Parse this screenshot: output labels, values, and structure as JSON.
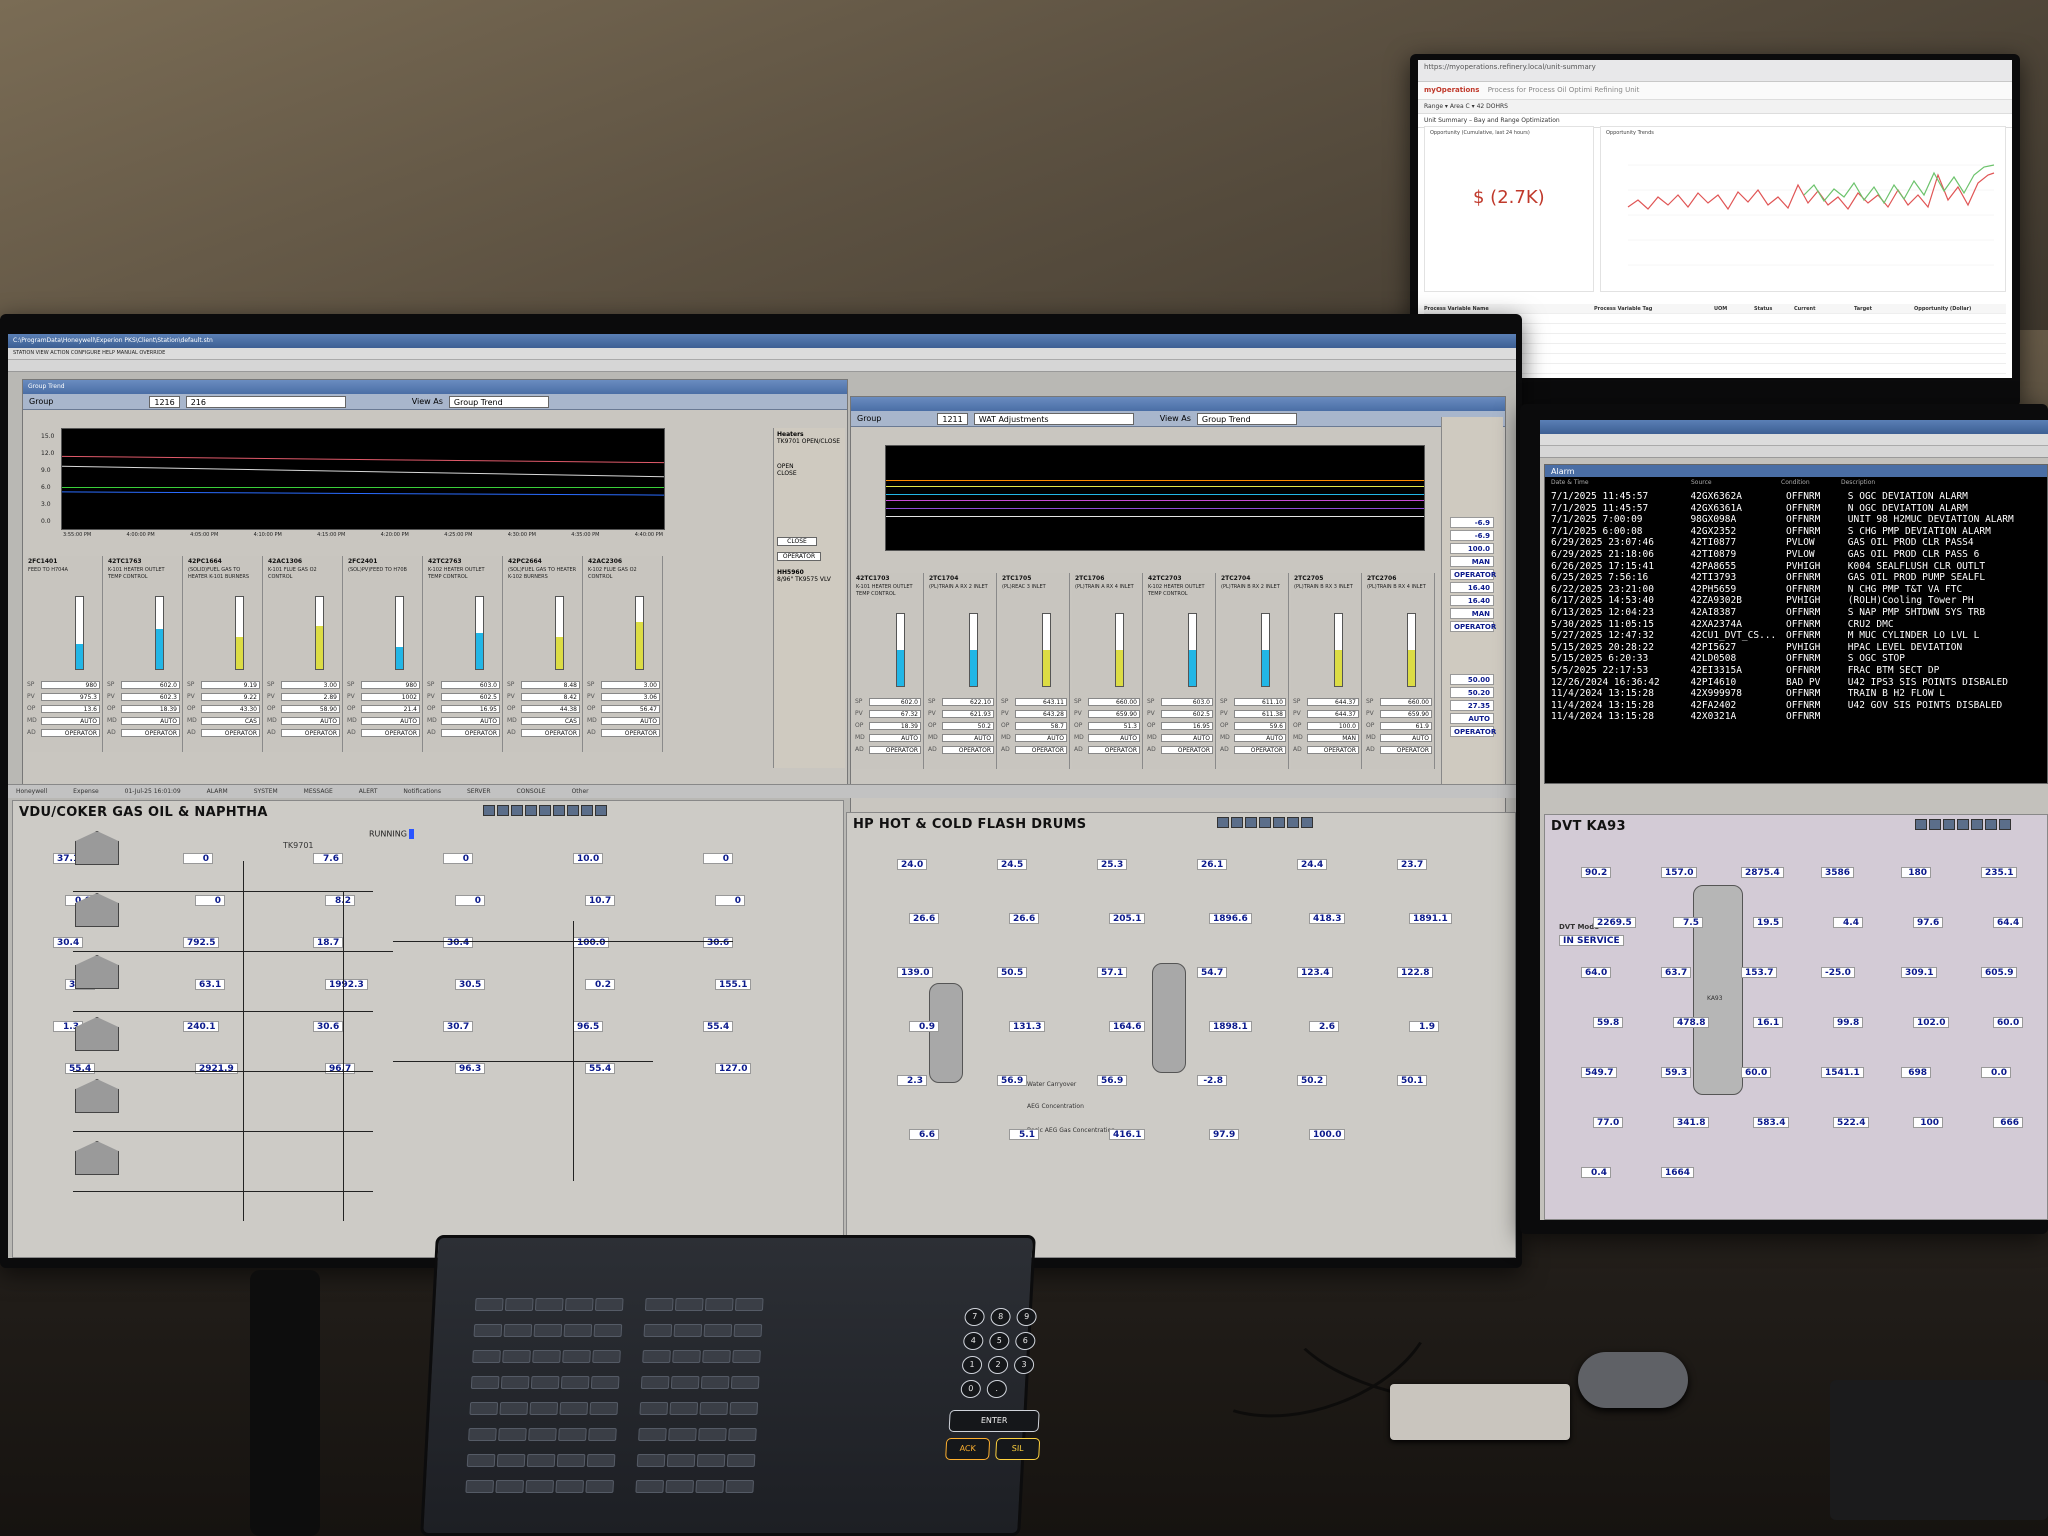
{
  "web_monitor": {
    "brand": "myOperations",
    "tagline": "Process for Process Oil Optimi Refining Unit",
    "filters": "Range ▾  Area C ▾  42 DOHRS",
    "breadcrumb": "Unit Summary – Bay and Range Optimization",
    "opportunity_title": "Opportunity (Cumulative, last 24 hours)",
    "opportunity_value": "$ (2.7K)",
    "trend_title": "Opportunity Trends",
    "table_headers": [
      "Process Variable Name",
      "Process Variable Tag",
      "UOM",
      "Status",
      "Current",
      "Target",
      "Opportunity (Dollar)"
    ]
  },
  "left_monitor": {
    "group_window": {
      "title": "Group Trend",
      "group_label": "Group",
      "group_number": "1216",
      "group_name": "216",
      "view_as_label": "View As",
      "view_as_value": "Group Trend",
      "y_ticks": [
        "15.0",
        "12.0",
        "9.0",
        "6.0",
        "3.0",
        "0.0"
      ],
      "x_ticks": [
        "3:55:00 PM",
        "4:00:00 PM",
        "4:05:00 PM",
        "4:10:00 PM",
        "4:15:00 PM",
        "4:20:00 PM",
        "4:25:00 PM",
        "4:30:00 PM",
        "4:35:00 PM",
        "4:40:00 PM"
      ]
    },
    "faceplates": [
      {
        "tag": "2FC1401",
        "desc": "FEED TO H704A",
        "sp": "980",
        "pv": "975.3",
        "op": "13.6",
        "md": "AUTO",
        "ad": "OPERATOR",
        "fill": 0.35
      },
      {
        "tag": "42TC1763",
        "desc": "K-101 HEATER OUTLET TEMP CONTROL",
        "sp": "602.0",
        "pv": "602.3",
        "op": "18.39",
        "md": "AUTO",
        "ad": "OPERATOR",
        "fill": 0.55
      },
      {
        "tag": "42PC1664",
        "desc": "(SOLID)FUEL GAS TO HEATER K-101 BURNERS",
        "sp": "9.19",
        "pv": "9.22",
        "op": "43.30",
        "md": "CAS",
        "ad": "OPERATOR",
        "fill": 0.45
      },
      {
        "tag": "42AC1306",
        "desc": "K-101 FLUE GAS O2 CONTROL",
        "sp": "3.00",
        "pv": "2.89",
        "op": "58.90",
        "md": "AUTO",
        "ad": "OPERATOR",
        "fill": 0.6
      },
      {
        "tag": "2FC2401",
        "desc": "(SOL)PV)FEED TO H70B",
        "sp": "980",
        "pv": "1002",
        "op": "21.4",
        "md": "AUTO",
        "ad": "OPERATOR",
        "fill": 0.3
      },
      {
        "tag": "42TC2763",
        "desc": "K-102 HEATER OUTLET TEMP CONTROL",
        "sp": "603.0",
        "pv": "602.5",
        "op": "16.95",
        "md": "AUTO",
        "ad": "OPERATOR",
        "fill": 0.5
      },
      {
        "tag": "42PC2664",
        "desc": "(SOL)FUEL GAS TO HEATER K-102 BURNERS",
        "sp": "8.48",
        "pv": "8.42",
        "op": "44.38",
        "md": "CAS",
        "ad": "OPERATOR",
        "fill": 0.45
      },
      {
        "tag": "42AC2306",
        "desc": "K-102 FLUE GAS O2 CONTROL",
        "sp": "3.00",
        "pv": "3.06",
        "op": "56.47",
        "md": "AUTO",
        "ad": "OPERATOR",
        "fill": 0.65
      }
    ],
    "side_panel": {
      "tag": "Heaters",
      "desc": "TK9701 OPEN/CLOSE",
      "open": "OPEN",
      "close": "CLOSE",
      "close_btn": "CLOSE",
      "operator": "OPERATOR",
      "tag2": "HH5960",
      "desc2": "8/96\" TK9575 VLV"
    },
    "status_items": [
      "Honeywell",
      "Expense",
      "01-Jul-25  16:01:09",
      "ALARM",
      "SYSTEM",
      "MESSAGE",
      "ALERT",
      "Notifications",
      "SERVER",
      "CONSOLE",
      "Other"
    ],
    "schematic_title": "VDU/COKER GAS OIL & NAPHTHA",
    "schematic_values": [
      {
        "id": "v1",
        "val": "37.1"
      },
      {
        "id": "v2",
        "val": "0"
      },
      {
        "id": "v3",
        "val": "7.6"
      },
      {
        "id": "v4",
        "val": "0"
      },
      {
        "id": "v5",
        "val": "10.0"
      },
      {
        "id": "v6",
        "val": "0"
      },
      {
        "id": "v7",
        "val": "0.0"
      },
      {
        "id": "v8",
        "val": "0"
      },
      {
        "id": "v9",
        "val": "8.2"
      },
      {
        "id": "v10",
        "val": "0"
      },
      {
        "id": "v11",
        "val": "10.7"
      },
      {
        "id": "v12",
        "val": "0"
      },
      {
        "id": "v13",
        "val": "30.4"
      },
      {
        "id": "v14",
        "val": "792.5"
      },
      {
        "id": "v15",
        "val": "18.7"
      },
      {
        "id": "v16",
        "val": "30.4"
      },
      {
        "id": "v17",
        "val": "100.0"
      },
      {
        "id": "v18",
        "val": "30.6"
      },
      {
        "id": "v19",
        "val": "30.5"
      },
      {
        "id": "v20",
        "val": "63.1"
      },
      {
        "id": "v21",
        "val": "1992.3"
      },
      {
        "id": "v22",
        "val": "30.5"
      },
      {
        "id": "v23",
        "val": "0.2"
      },
      {
        "id": "v24",
        "val": "155.1"
      },
      {
        "id": "v25",
        "val": "1.3"
      },
      {
        "id": "v26",
        "val": "240.1"
      },
      {
        "id": "v27",
        "val": "30.6"
      },
      {
        "id": "v28",
        "val": "30.7"
      },
      {
        "id": "v29",
        "val": "96.5"
      },
      {
        "id": "v30",
        "val": "55.4"
      },
      {
        "id": "v31",
        "val": "55.4"
      },
      {
        "id": "v32",
        "val": "2921.9"
      },
      {
        "id": "v33",
        "val": "96.7"
      },
      {
        "id": "v34",
        "val": "96.3"
      },
      {
        "id": "v35",
        "val": "55.4"
      },
      {
        "id": "v36",
        "val": "127.0"
      }
    ],
    "running_label": "RUNNING",
    "tk_label": "TK9701"
  },
  "middle_window": {
    "group_number": "1211",
    "group_name": "WAT Adjustments",
    "view_as_value": "Group Trend",
    "faceplates": [
      {
        "tag": "42TC1703",
        "desc": "K-101 HEATER OUTLET TEMP CONTROL",
        "sp": "602.0",
        "pv": "67.32",
        "op": "18.39",
        "md": "AUTO",
        "ad": "OPERATOR"
      },
      {
        "tag": "2TC1704",
        "desc": "(PL)TRAIN A RX 2 INLET",
        "sp": "622.10",
        "pv": "621.93",
        "op": "50.2",
        "md": "AUTO",
        "ad": "OPERATOR"
      },
      {
        "tag": "2TC1705",
        "desc": "(PL)REAC 3 INLET",
        "sp": "643.11",
        "pv": "643.28",
        "op": "58.7",
        "md": "AUTO",
        "ad": "OPERATOR"
      },
      {
        "tag": "2TC1706",
        "desc": "(PL)TRAIN A RX 4 INLET",
        "sp": "660.00",
        "pv": "659.90",
        "op": "51.3",
        "md": "AUTO",
        "ad": "OPERATOR"
      },
      {
        "tag": "42TC2703",
        "desc": "K-102 HEATER OUTLET TEMP CONTROL",
        "sp": "603.0",
        "pv": "602.5",
        "op": "16.95",
        "md": "AUTO",
        "ad": "OPERATOR"
      },
      {
        "tag": "2TC2704",
        "desc": "(PL)TRAIN B RX 2 INLET",
        "sp": "611.10",
        "pv": "611.38",
        "op": "59.6",
        "md": "AUTO",
        "ad": "OPERATOR"
      },
      {
        "tag": "2TC2705",
        "desc": "(PL)TRAIN B RX 3 INLET",
        "sp": "644.37",
        "pv": "644.37",
        "op": "100.0",
        "md": "MAN",
        "ad": "OPERATOR"
      },
      {
        "tag": "2TC2706",
        "desc": "(PL)TRAIN B RX 4 INLET",
        "sp": "660.00",
        "pv": "659.90",
        "op": "61.9",
        "md": "AUTO",
        "ad": "OPERATOR"
      }
    ],
    "schematic_title": "HP HOT & COLD FLASH DRUMS",
    "schematic_values": [
      {
        "id": "m1",
        "val": "24.0"
      },
      {
        "id": "m2",
        "val": "24.5"
      },
      {
        "id": "m3",
        "val": "25.3"
      },
      {
        "id": "m4",
        "val": "26.1"
      },
      {
        "id": "m5",
        "val": "24.4"
      },
      {
        "id": "m6",
        "val": "23.7"
      },
      {
        "id": "m7",
        "val": "26.6"
      },
      {
        "id": "m8",
        "val": "26.6"
      },
      {
        "id": "m9",
        "val": "205.1"
      },
      {
        "id": "m10",
        "val": "1896.6"
      },
      {
        "id": "m11",
        "val": "418.3"
      },
      {
        "id": "m12",
        "val": "1891.1"
      },
      {
        "id": "m13",
        "val": "139.0"
      },
      {
        "id": "m14",
        "val": "50.5"
      },
      {
        "id": "m15",
        "val": "57.1"
      },
      {
        "id": "m16",
        "val": "54.7"
      },
      {
        "id": "m17",
        "val": "123.4"
      },
      {
        "id": "m18",
        "val": "122.8"
      },
      {
        "id": "m19",
        "val": "0.9"
      },
      {
        "id": "m20",
        "val": "131.3"
      },
      {
        "id": "m21",
        "val": "164.6"
      },
      {
        "id": "m22",
        "val": "1898.1"
      },
      {
        "id": "m23",
        "val": "2.6"
      },
      {
        "id": "m24",
        "val": "1.9"
      },
      {
        "id": "m25",
        "val": "2.3"
      },
      {
        "id": "m26",
        "val": "56.9"
      },
      {
        "id": "m27",
        "val": "56.9"
      },
      {
        "id": "m28",
        "val": "-2.8"
      },
      {
        "id": "m29",
        "val": "50.2"
      },
      {
        "id": "m30",
        "val": "50.1"
      },
      {
        "id": "m31",
        "val": "6.6"
      },
      {
        "id": "m32",
        "val": "5.1"
      },
      {
        "id": "m33",
        "val": "416.1"
      },
      {
        "id": "m34",
        "val": "97.9"
      },
      {
        "id": "m35",
        "val": "100.0"
      }
    ],
    "labels": {
      "water_carryover": "Water Carryover",
      "aeg": "AEG Concentration",
      "basic": "Basic AEG Gas Concentration"
    },
    "side_values": [
      {
        "val": "-6.9"
      },
      {
        "val": "-6.9"
      },
      {
        "val": "100.0"
      },
      {
        "val": "MAN"
      },
      {
        "val": "OPERATOR"
      },
      {
        "val": "16.40"
      },
      {
        "val": "16.40"
      },
      {
        "val": "MAN"
      },
      {
        "val": "OPERATOR"
      },
      {
        "val": "50.00"
      },
      {
        "val": "50.20"
      },
      {
        "val": "27.35"
      },
      {
        "val": "AUTO"
      },
      {
        "val": "OPERATOR"
      }
    ]
  },
  "right_monitor": {
    "alarm_title": "Alarm",
    "columns": [
      "Date & Time",
      "Source",
      "Condition",
      "Description"
    ],
    "alarms": [
      {
        "time": "7/1/2025 11:45:57",
        "src": "42GX6362A",
        "cond": "OFFNRM",
        "desc": "S OGC DEVIATION ALARM"
      },
      {
        "time": "7/1/2025 11:45:57",
        "src": "42GX6361A",
        "cond": "OFFNRM",
        "desc": "N OGC DEVIATION ALARM"
      },
      {
        "time": "7/1/2025 7:00:09",
        "src": "98GX098A",
        "cond": "OFFNRM",
        "desc": "UNIT 98 H2MUC DEVIATION ALARM"
      },
      {
        "time": "7/1/2025 6:00:08",
        "src": "42GX2352",
        "cond": "OFFNRM",
        "desc": "S CHG PMP DEVIATION  ALARM"
      },
      {
        "time": "6/29/2025 23:07:46",
        "src": "42TI0877",
        "cond": "PVLOW",
        "desc": "GAS OIL PROD CLR PASS4"
      },
      {
        "time": "6/29/2025 21:18:06",
        "src": "42TI0879",
        "cond": "PVLOW",
        "desc": "GAS OIL PROD CLR PASS 6"
      },
      {
        "time": "6/26/2025 17:15:41",
        "src": "42PA8655",
        "cond": "PVHIGH",
        "desc": "K004 SEALFLUSH CLR OUTLT"
      },
      {
        "time": "6/25/2025 7:56:16",
        "src": "42TI3793",
        "cond": "OFFNRM",
        "desc": "GAS OIL PROD PUMP SEALFL"
      },
      {
        "time": "6/22/2025 23:21:00",
        "src": "42PH5659",
        "cond": "OFFNRM",
        "desc": "N CHG PMP T&T VA FTC"
      },
      {
        "time": "6/17/2025 14:53:40",
        "src": "42ZA9302B",
        "cond": "PVHIGH",
        "desc": "(ROLH)Cooling Tower PH"
      },
      {
        "time": "6/13/2025 12:04:23",
        "src": "42AI8387",
        "cond": "OFFNRM",
        "desc": "S NAP PMP SHTDWN SYS TRB"
      },
      {
        "time": "5/30/2025 11:05:15",
        "src": "42XA2374A",
        "cond": "OFFNRM",
        "desc": "CRU2 DMC"
      },
      {
        "time": "5/27/2025 12:47:32",
        "src": "42CU1_DVT_CS...",
        "cond": "OFFNRM",
        "desc": "M MUC CYLINDER LO LVL L"
      },
      {
        "time": "5/15/2025 20:28:22",
        "src": "42PI5627",
        "cond": "PVHIGH",
        "desc": "HPAC LEVEL DEVIATION"
      },
      {
        "time": "5/15/2025 6:20:33",
        "src": "42LD0508",
        "cond": "OFFNRM",
        "desc": "S OGC STOP"
      },
      {
        "time": "5/5/2025 22:17:53",
        "src": "42EI3315A",
        "cond": "OFFNRM",
        "desc": "FRAC BTM SECT DP"
      },
      {
        "time": "12/26/2024 16:36:42",
        "src": "42PI4610",
        "cond": "BAD PV",
        "desc": "U42 IPS3 SIS POINTS DISBALED"
      },
      {
        "time": "11/4/2024 13:15:28",
        "src": "42X999978",
        "cond": "OFFNRM",
        "desc": "TRAIN B H2 FLOW L"
      },
      {
        "time": "11/4/2024 13:15:28",
        "src": "42FA2402",
        "cond": "OFFNRM",
        "desc": "U42 GOV SIS POINTS DISBALED"
      },
      {
        "time": "11/4/2024 13:15:28",
        "src": "42X0321A",
        "cond": "OFFNRM",
        "desc": ""
      }
    ],
    "schematic_title": "DVT KA93",
    "schematic_values": [
      {
        "val": "90.2"
      },
      {
        "val": "157.0"
      },
      {
        "val": "2875.4"
      },
      {
        "val": "3586"
      },
      {
        "val": "180"
      },
      {
        "val": "235.1"
      },
      {
        "val": "2269.5"
      },
      {
        "val": "7.5"
      },
      {
        "val": "19.5"
      },
      {
        "val": "4.4"
      },
      {
        "val": "97.6"
      },
      {
        "val": "64.4"
      },
      {
        "val": "64.0"
      },
      {
        "val": "63.7"
      },
      {
        "val": "153.7"
      },
      {
        "val": "-25.0"
      },
      {
        "val": "309.1"
      },
      {
        "val": "605.9"
      },
      {
        "val": "59.8"
      },
      {
        "val": "478.8"
      },
      {
        "val": "16.1"
      },
      {
        "val": "99.8"
      },
      {
        "val": "102.0"
      },
      {
        "val": "60.0"
      },
      {
        "val": "549.7"
      },
      {
        "val": "59.3"
      },
      {
        "val": "60.0"
      },
      {
        "val": "1541.1"
      },
      {
        "val": "698"
      },
      {
        "val": "0.0"
      },
      {
        "val": "77.0"
      },
      {
        "val": "341.8"
      },
      {
        "val": "583.4"
      },
      {
        "val": "522.4"
      },
      {
        "val": "100"
      },
      {
        "val": "666"
      },
      {
        "val": "0.4"
      },
      {
        "val": "1664"
      }
    ],
    "dvt_mode_label": "DVT Mode",
    "dvt_mode_value": "IN SERVICE",
    "vessel_label": "KA93"
  },
  "keyboard": {
    "enter": "ENTER",
    "ack": "ACK",
    "sil": "SIL",
    "numbers": [
      "7",
      "8",
      "9",
      "4",
      "5",
      "6",
      "1",
      "2",
      "3",
      "0",
      "."
    ]
  },
  "colors": {
    "trend_left": [
      "#e05a6a",
      "#d8d8d8",
      "#3ad03a",
      "#2a6cff"
    ],
    "trend_mid": [
      "#ff8c00",
      "#e5e54a",
      "#22b6e6",
      "#c64bd8",
      "#8d4bd8",
      "#e4e4e4"
    ],
    "accent_red": "#c0392b",
    "value_blue": "#0b1a8c"
  }
}
